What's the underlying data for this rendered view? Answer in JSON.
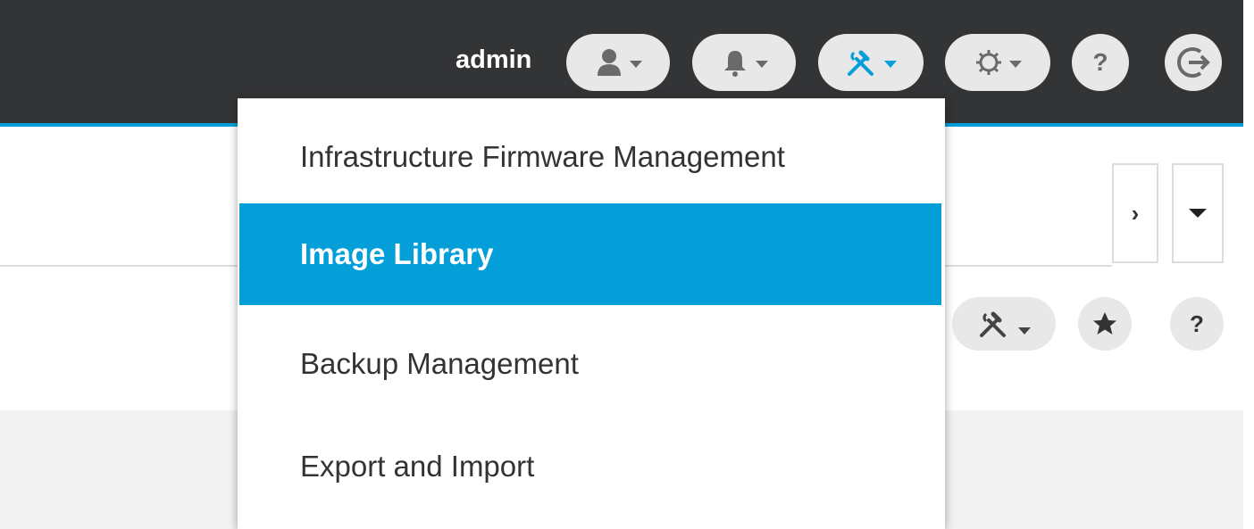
{
  "header": {
    "username": "admin",
    "accent_color": "#049fd9",
    "bar_color": "#333436",
    "buttons": [
      {
        "icon": "user-icon",
        "has_caret": true
      },
      {
        "icon": "bell-icon",
        "has_caret": true
      },
      {
        "icon": "tools-icon",
        "has_caret": true,
        "active": true
      },
      {
        "icon": "gear-icon",
        "has_caret": true
      },
      {
        "icon": "help-icon",
        "label": "?"
      },
      {
        "icon": "logout-icon"
      }
    ]
  },
  "tools_menu": {
    "items": [
      {
        "label": "Infrastructure Firmware Management",
        "active": false
      },
      {
        "label": "Image Library",
        "active": true
      },
      {
        "label": "Backup Management",
        "active": false
      },
      {
        "label": "Export and Import",
        "active": false
      }
    ]
  },
  "page": {
    "pager": {
      "next_label": "›"
    },
    "help_label": "?"
  }
}
